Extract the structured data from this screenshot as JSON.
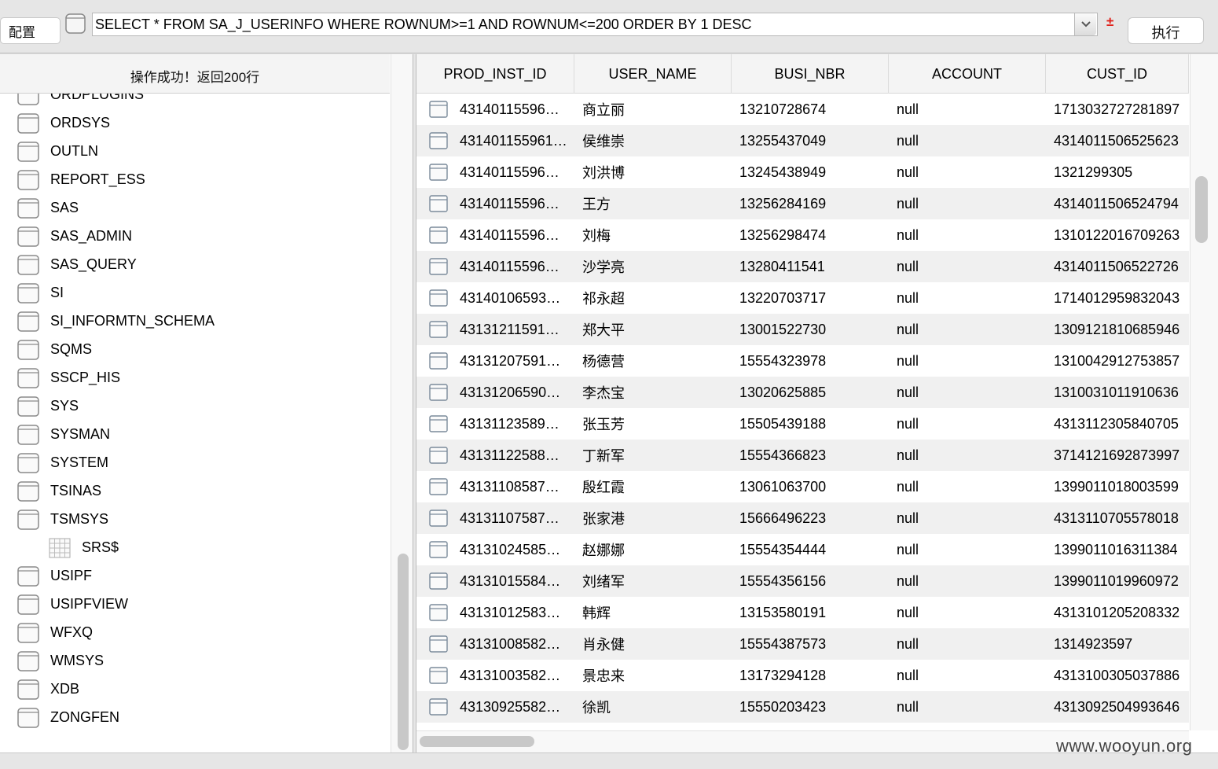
{
  "toolbar": {
    "config_label": "配置",
    "sql": "SELECT * FROM SA_J_USERINFO WHERE ROWNUM>=1 AND ROWNUM<=200 ORDER BY 1 DESC",
    "toggle_symbol": "±",
    "execute_label": "执行"
  },
  "left": {
    "status": "操作成功！返回200行",
    "tree": [
      {
        "label": "ORDPLUGINS",
        "type": "schema"
      },
      {
        "label": "ORDSYS",
        "type": "schema"
      },
      {
        "label": "OUTLN",
        "type": "schema"
      },
      {
        "label": "REPORT_ESS",
        "type": "schema"
      },
      {
        "label": "SAS",
        "type": "schema"
      },
      {
        "label": "SAS_ADMIN",
        "type": "schema"
      },
      {
        "label": "SAS_QUERY",
        "type": "schema"
      },
      {
        "label": "SI",
        "type": "schema"
      },
      {
        "label": "SI_INFORMTN_SCHEMA",
        "type": "schema"
      },
      {
        "label": "SQMS",
        "type": "schema"
      },
      {
        "label": "SSCP_HIS",
        "type": "schema"
      },
      {
        "label": "SYS",
        "type": "schema"
      },
      {
        "label": "SYSMAN",
        "type": "schema"
      },
      {
        "label": "SYSTEM",
        "type": "schema"
      },
      {
        "label": "TSINAS",
        "type": "schema"
      },
      {
        "label": "TSMSYS",
        "type": "schema"
      },
      {
        "label": "SRS$",
        "type": "table"
      },
      {
        "label": "USIPF",
        "type": "schema"
      },
      {
        "label": "USIPFVIEW",
        "type": "schema"
      },
      {
        "label": "WFXQ",
        "type": "schema"
      },
      {
        "label": "WMSYS",
        "type": "schema"
      },
      {
        "label": "XDB",
        "type": "schema"
      },
      {
        "label": "ZONGFEN",
        "type": "schema"
      }
    ]
  },
  "grid": {
    "columns": [
      "PROD_INST_ID",
      "USER_NAME",
      "BUSI_NBR",
      "ACCOUNT",
      "CUST_ID"
    ],
    "rows": [
      [
        "43140115596…",
        "商立丽",
        "13210728674",
        "null",
        "1713032727281897"
      ],
      [
        "431401155961…",
        "侯维崇",
        "13255437049",
        "null",
        "4314011506525623"
      ],
      [
        "43140115596…",
        "刘洪博",
        "13245438949",
        "null",
        "1321299305"
      ],
      [
        "43140115596…",
        "王方",
        "13256284169",
        "null",
        "4314011506524794"
      ],
      [
        "43140115596…",
        "刘梅",
        "13256298474",
        "null",
        "1310122016709263"
      ],
      [
        "43140115596…",
        "沙学亮",
        "13280411541",
        "null",
        "4314011506522726"
      ],
      [
        "43140106593…",
        "祁永超",
        "13220703717",
        "null",
        "1714012959832043"
      ],
      [
        "43131211591…",
        "郑大平",
        "13001522730",
        "null",
        "1309121810685946"
      ],
      [
        "43131207591…",
        "杨德营",
        "15554323978",
        "null",
        "1310042912753857"
      ],
      [
        "43131206590…",
        "李杰宝",
        "13020625885",
        "null",
        "1310031011910636"
      ],
      [
        "43131123589…",
        "张玉芳",
        "15505439188",
        "null",
        "4313112305840705"
      ],
      [
        "43131122588…",
        "丁新军",
        "15554366823",
        "null",
        "3714121692873997"
      ],
      [
        "43131108587…",
        "殷红霞",
        "13061063700",
        "null",
        "1399011018003599"
      ],
      [
        "43131107587…",
        "张家港",
        "15666496223",
        "null",
        "4313110705578018"
      ],
      [
        "43131024585…",
        "赵娜娜",
        "15554354444",
        "null",
        "1399011016311384"
      ],
      [
        "43131015584…",
        "刘绪军",
        "15554356156",
        "null",
        "1399011019960972"
      ],
      [
        "43131012583…",
        "韩辉",
        "13153580191",
        "null",
        "4313101205208332"
      ],
      [
        "43131008582…",
        "肖永健",
        "15554387573",
        "null",
        "1314923597"
      ],
      [
        "43131003582…",
        "景忠来",
        "13173294128",
        "null",
        "4313100305037886"
      ],
      [
        "43130925582…",
        "徐凯",
        "15550203423",
        "null",
        "4313092504993646"
      ]
    ]
  },
  "watermark": "www.wooyun.org"
}
